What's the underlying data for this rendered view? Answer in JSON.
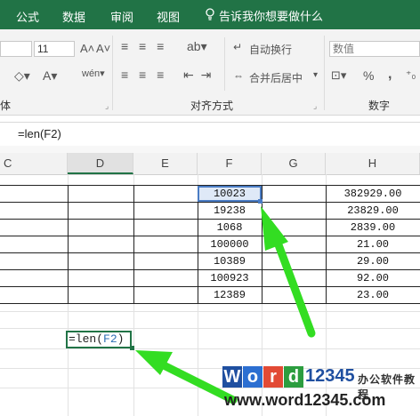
{
  "tabs": [
    "公式",
    "数据",
    "审阅",
    "视图"
  ],
  "tell_me": "告诉我你想要做什么",
  "ribbon": {
    "font_size": "11",
    "font_group": "体",
    "wrap_text": "自动换行",
    "merge_center": "合并后居中",
    "align_group": "对齐方式",
    "number_format": "数值",
    "percent": "%",
    "comma": ",",
    "number_group": "数字"
  },
  "formula_bar": "=len(F2)",
  "columns": [
    "C",
    "D",
    "E",
    "F",
    "G",
    "H"
  ],
  "col_f": [
    "10023",
    "19238",
    "1068",
    "100000",
    "10389",
    "100923",
    "12389"
  ],
  "col_h": [
    "382929.00",
    "23829.00",
    "2839.00",
    "21.00",
    "29.00",
    "92.00",
    "23.00"
  ],
  "edit": {
    "prefix": "=len(",
    "ref": "F2",
    "suffix": ")"
  },
  "watermark": {
    "w": "W",
    "o": "o",
    "r": "r",
    "d": "d",
    "num": "12345",
    "cn": "办公软件教程",
    "url": "www.word12345.com"
  },
  "colors": {
    "excel_green": "#217346",
    "arrow_green": "#33dd22"
  }
}
